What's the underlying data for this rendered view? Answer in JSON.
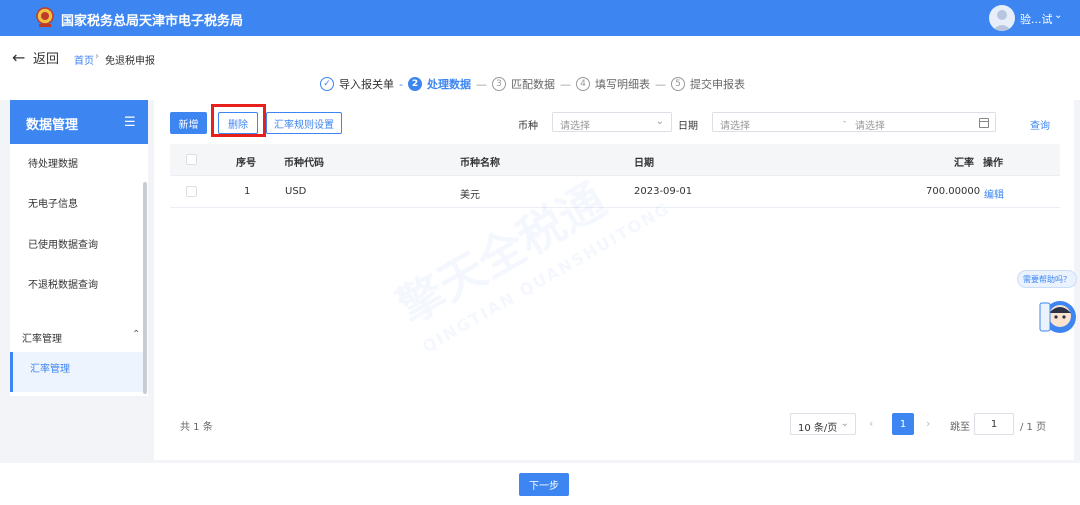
{
  "header": {
    "title": "国家税务总局天津市电子税务局",
    "user_name": "验...试",
    "emblem_icon": "tax-emblem-icon",
    "avatar_icon": "user-avatar-icon"
  },
  "nav": {
    "back_label": "返回",
    "breadcrumb_home": "首页",
    "breadcrumb_sep": "›",
    "breadcrumb_current": "免退税申报"
  },
  "steps": [
    {
      "num": "✓",
      "label": "导入报关单",
      "state": "done"
    },
    {
      "num": "2",
      "label": "处理数据",
      "state": "active"
    },
    {
      "num": "3",
      "label": "匹配数据",
      "state": "pending"
    },
    {
      "num": "4",
      "label": "填写明细表",
      "state": "pending"
    },
    {
      "num": "5",
      "label": "提交申报表",
      "state": "pending"
    }
  ],
  "sidebar": {
    "title": "数据管理",
    "items": [
      {
        "label": "待处理数据"
      },
      {
        "label": "无电子信息"
      },
      {
        "label": "已使用数据查询"
      },
      {
        "label": "不退税数据查询"
      }
    ],
    "group_label": "汇率管理",
    "group_item": "汇率管理"
  },
  "toolbar": {
    "add_label": "新增",
    "delete_label": "删除",
    "rule_label": "汇率规则设置",
    "currency_label": "币种",
    "currency_placeholder": "请选择",
    "date_label": "日期",
    "date_start_placeholder": "请选择",
    "date_end_placeholder": "请选择",
    "date_sep": "-",
    "query_label": "查询"
  },
  "table": {
    "headers": [
      "序号",
      "币种代码",
      "币种名称",
      "日期",
      "汇率",
      "操作"
    ],
    "rows": [
      {
        "index": "1",
        "code": "USD",
        "name": "美元",
        "date": "2023-09-01",
        "rate": "700.00000",
        "action": "编辑"
      }
    ]
  },
  "pagination": {
    "total": "共 1 条",
    "page_size": "10 条/页",
    "current_page": "1",
    "jump_label": "跳至",
    "jump_value": "1",
    "total_pages": "/ 1 页"
  },
  "footer": {
    "next_label": "下一步"
  },
  "help": {
    "bubble": "需要帮助吗？"
  },
  "watermark": {
    "text": "擎天全税通",
    "sub": "QINGTIAN QUANSHUITONG"
  },
  "colors": {
    "primary": "#3d86f2",
    "highlight": "#e8201b"
  }
}
